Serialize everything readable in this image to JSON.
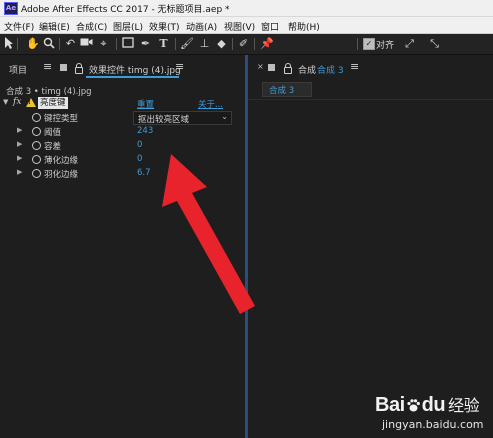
{
  "window": {
    "title": "Adobe After Effects CC 2017 - 无标题项目.aep *",
    "app_icon": "Ae"
  },
  "menu": [
    "文件(F)",
    "编辑(E)",
    "合成(C)",
    "图层(L)",
    "效果(T)",
    "动画(A)",
    "视图(V)",
    "窗口",
    "帮助(H)"
  ],
  "toolbar": {
    "snap_label": "对齐",
    "snap_checked": "✓"
  },
  "left_panel": {
    "project_tab": "项目",
    "effects_tab": "效果控件 timg (4).jpg",
    "breadcrumb": "合成 3 • timg (4).jpg",
    "effect": {
      "fx": "fx",
      "warn": "!",
      "name": "亮度键",
      "reset": "重置",
      "about": "关于..."
    },
    "properties": [
      {
        "label": "键控类型",
        "value": "抠出较亮区域",
        "dropdown": true
      },
      {
        "label": "阈值",
        "value": "243"
      },
      {
        "label": "容差",
        "value": "0"
      },
      {
        "label": "薄化边缘",
        "value": "0"
      },
      {
        "label": "羽化边缘",
        "value": "6.7"
      }
    ]
  },
  "right_panel": {
    "tab_prefix": "合成",
    "tab_name": "合成 3",
    "comp_chip": "合成 3"
  },
  "watermark": {
    "brand_left": "Bai",
    "brand_right": "du",
    "suffix": "经验",
    "url": "jingyan.baidu.com"
  },
  "colors": {
    "accent_blue": "#3e9bd9",
    "panel_bg": "#1e1e1e",
    "arrow_red": "#e8232b"
  }
}
